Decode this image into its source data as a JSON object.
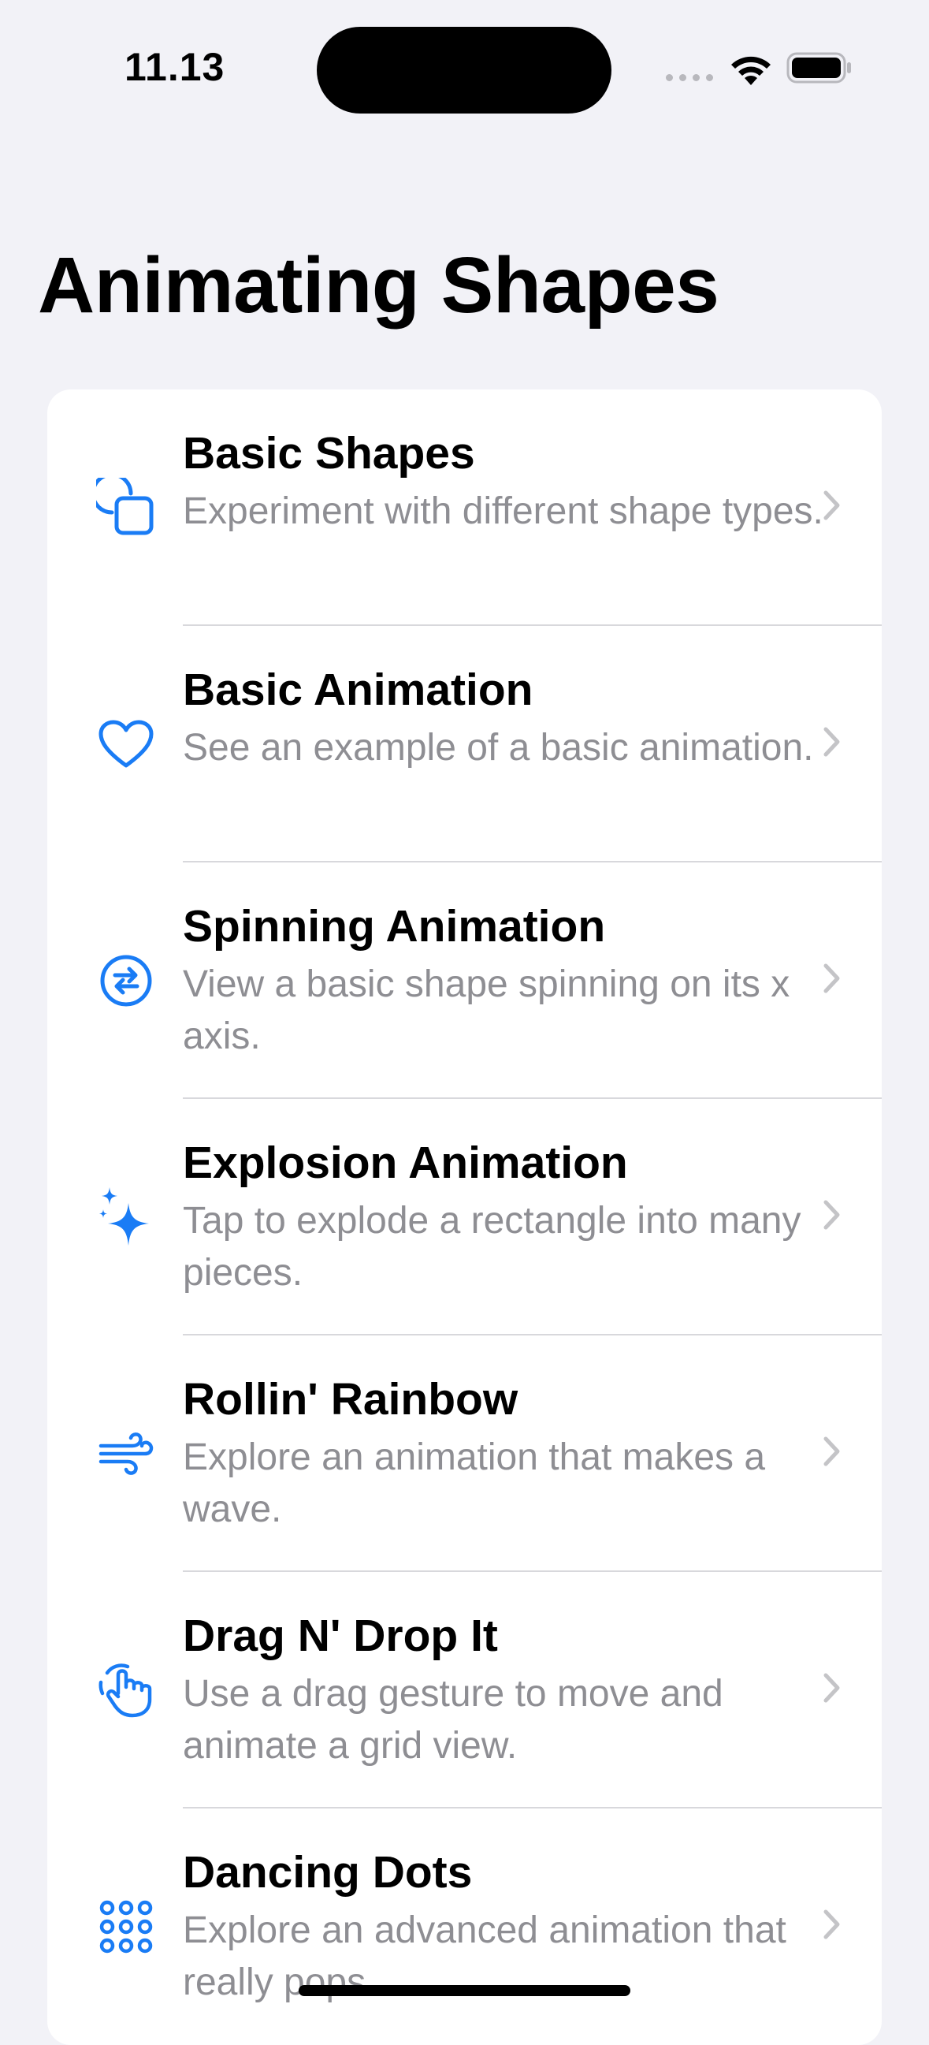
{
  "status_bar": {
    "time": "11.13"
  },
  "page_title": "Animating Shapes",
  "accent_color": "#1a7cf5",
  "items": [
    {
      "title": "Basic Shapes",
      "subtitle": "Experiment with different shape types.",
      "icon": "square-on-square-icon"
    },
    {
      "title": "Basic Animation",
      "subtitle": "See an example of a basic animation.",
      "icon": "heart-icon"
    },
    {
      "title": "Spinning Animation",
      "subtitle": "View a basic shape spinning on its x axis.",
      "icon": "arrows-circle-icon"
    },
    {
      "title": "Explosion Animation",
      "subtitle": "Tap to explode a rectangle into many pieces.",
      "icon": "sparkles-icon"
    },
    {
      "title": "Rollin' Rainbow",
      "subtitle": "Explore an animation that makes a wave.",
      "icon": "wind-icon"
    },
    {
      "title": "Drag N' Drop It",
      "subtitle": "Use a drag gesture to move and animate a grid view.",
      "icon": "hand-tap-icon"
    },
    {
      "title": "Dancing Dots",
      "subtitle": "Explore an advanced animation that really pops.",
      "icon": "dot-grid-icon"
    }
  ]
}
